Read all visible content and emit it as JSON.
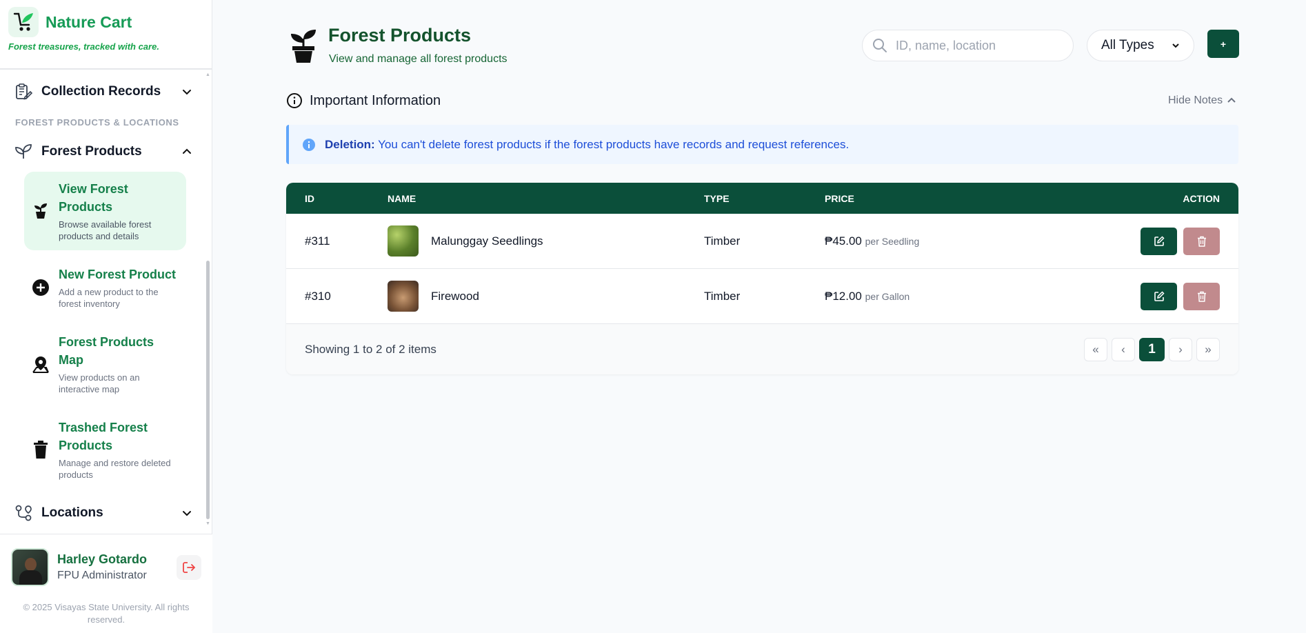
{
  "brand": {
    "name": "Nature Cart",
    "tagline": "Forest treasures, tracked with care."
  },
  "sidebar": {
    "collection_records": "Collection Records",
    "section_label": "FOREST PRODUCTS & LOCATIONS",
    "forest_products": "Forest Products",
    "sub_items": [
      {
        "title": "View Forest Products",
        "desc": "Browse available forest products and details",
        "icon": "potted-plant-icon",
        "active": true
      },
      {
        "title": "New Forest Product",
        "desc": "Add a new product to the forest inventory",
        "icon": "plus-circle-icon"
      },
      {
        "title": "Forest Products Map",
        "desc": "View products on an interactive map",
        "icon": "map-pin-icon"
      },
      {
        "title": "Trashed Forest Products",
        "desc": "Manage and restore deleted products",
        "icon": "trash-icon"
      }
    ],
    "locations": "Locations"
  },
  "user": {
    "name": "Harley Gotardo",
    "role": "FPU Administrator"
  },
  "copyright": "© 2025 Visayas State University. All rights reserved.",
  "header": {
    "title": "Forest Products",
    "subtitle": "View and manage all forest products"
  },
  "search": {
    "placeholder": "ID, name, location",
    "value": ""
  },
  "type_filter": {
    "selected": "All Types"
  },
  "add_button": {
    "label": "+"
  },
  "info": {
    "title": "Important Information",
    "toggle": "Hide Notes"
  },
  "notice": {
    "label": "Deletion:",
    "text": "You can't delete forest products if the forest products have records and request references."
  },
  "table": {
    "columns": [
      "ID",
      "NAME",
      "TYPE",
      "PRICE",
      "ACTION"
    ],
    "rows": [
      {
        "id": "#311",
        "name": "Malunggay Seedlings",
        "type": "Timber",
        "price": "₱45.00",
        "unit": "per Seedling"
      },
      {
        "id": "#310",
        "name": "Firewood",
        "type": "Timber",
        "price": "₱12.00",
        "unit": "per Gallon"
      }
    ],
    "showing": "Showing 1 to 2 of 2 items",
    "pager": {
      "first": "«",
      "prev": "‹",
      "current": "1",
      "next": "›",
      "last": "»"
    }
  },
  "colors": {
    "primary": "#0b4f3a",
    "brand_green": "#16a34a",
    "notice_blue": "#1d4ed8",
    "delete_muted": "#c18a8d"
  }
}
